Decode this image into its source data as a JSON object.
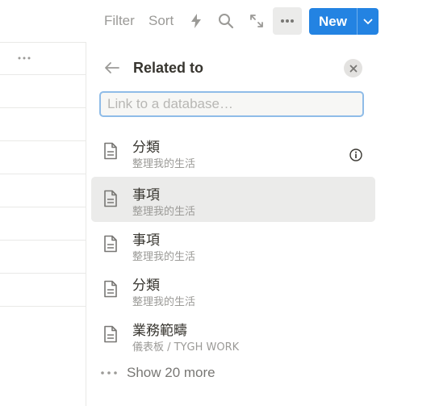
{
  "toolbar": {
    "filter_label": "Filter",
    "sort_label": "Sort",
    "icons": [
      "lightning-icon",
      "search-icon",
      "expand-icon",
      "more-icon"
    ],
    "new_label": "New"
  },
  "panel": {
    "title": "Related to",
    "search_placeholder": "Link to a database…",
    "items": [
      {
        "title": "分類",
        "subtitle": "整理我的生活",
        "icon": "page-icon"
      },
      {
        "title": "事項",
        "subtitle": "整理我的生活",
        "icon": "page-icon"
      },
      {
        "title": "事項",
        "subtitle": "整理我的生活",
        "icon": "page-icon"
      },
      {
        "title": "分類",
        "subtitle": "整理我的生活",
        "icon": "page-icon"
      },
      {
        "title": "業務範疇",
        "subtitle": "儀表板 / TYGH WORK",
        "icon": "page-icon"
      }
    ],
    "show_more_label": "Show 20 more"
  },
  "colors": {
    "accent": "#2383e2",
    "hover": "#ebebea",
    "muted_text": "#9b9a97",
    "focus_ring": "#8fbce8"
  }
}
